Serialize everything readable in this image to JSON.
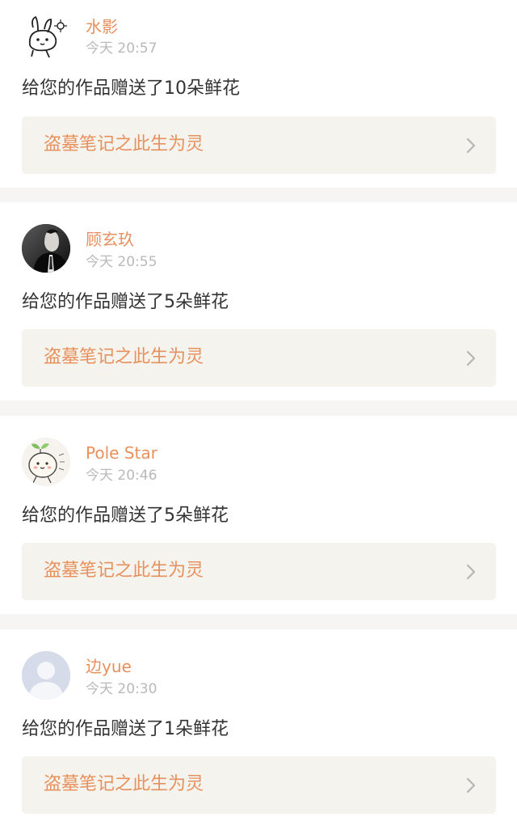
{
  "notifications": [
    {
      "avatar_icon": "rabbit-doodle-avatar",
      "username": "水影",
      "time": "今天 20:57",
      "message": "给您的作品赠送了10朵鲜花",
      "work_title": "盗墓笔记之此生为灵"
    },
    {
      "avatar_icon": "man-in-suit-avatar",
      "username": "顾玄玖",
      "time": "今天 20:55",
      "message": "给您的作品赠送了5朵鲜花",
      "work_title": "盗墓笔记之此生为灵"
    },
    {
      "avatar_icon": "sprout-character-avatar",
      "username": "Pole Star",
      "time": "今天 20:46",
      "message": "给您的作品赠送了5朵鲜花",
      "work_title": "盗墓笔记之此生为灵"
    },
    {
      "avatar_icon": "default-user-avatar",
      "username": "边yue",
      "time": "今天 20:30",
      "message": "给您的作品赠送了1朵鲜花",
      "work_title": "盗墓笔记之此生为灵"
    }
  ],
  "colors": {
    "accent": "#e8905c",
    "background": "#f7f4f4",
    "link_box": "#f4f3ee",
    "text": "#333333",
    "muted": "#b9b9b9"
  }
}
